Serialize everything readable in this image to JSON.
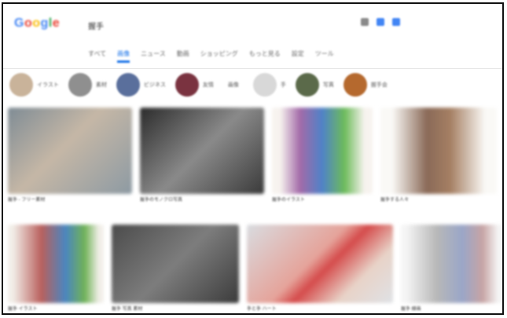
{
  "header": {
    "logo_letters": [
      {
        "char": "G",
        "color": "#4285f4"
      },
      {
        "char": "o",
        "color": "#ea4335"
      },
      {
        "char": "o",
        "color": "#fbbc05"
      },
      {
        "char": "g",
        "color": "#4285f4"
      },
      {
        "char": "l",
        "color": "#34a853"
      },
      {
        "char": "e",
        "color": "#ea4335"
      }
    ],
    "search_query": "握手",
    "icons": [
      {
        "name": "camera-search-icon",
        "color": "#8a8a8a"
      },
      {
        "name": "voice-mic-icon",
        "color": "#4285f4"
      },
      {
        "name": "search-icon",
        "color": "#4285f4"
      }
    ]
  },
  "tabs": [
    {
      "label": "すべて",
      "active": false
    },
    {
      "label": "画像",
      "active": true
    },
    {
      "label": "ニュース",
      "active": false
    },
    {
      "label": "動画",
      "active": false
    },
    {
      "label": "ショッピング",
      "active": false
    },
    {
      "label": "もっと見る",
      "active": false
    },
    {
      "label": "設定",
      "active": false
    },
    {
      "label": "ツール",
      "active": false
    }
  ],
  "chips": [
    {
      "label": "イラスト",
      "color": "#c9b39a"
    },
    {
      "label": "素材",
      "color": "#8f8f8f"
    },
    {
      "label": "ビジネス",
      "color": "#5a6f9c"
    },
    {
      "label": "友情",
      "color": "#7a3340"
    },
    {
      "label": "画像",
      "color": ""
    },
    {
      "label": "手",
      "color": "#d8d8d8"
    },
    {
      "label": "写真",
      "color": "#5b6a4a"
    },
    {
      "label": "握手会",
      "color": "#b5692e"
    }
  ],
  "results_row1": [
    {
      "caption": "握手 - フリー素材",
      "gradient": "linear-gradient(135deg,#7f8c95,#c5b7a6 45%,#8d9aa3)"
    },
    {
      "caption": "握手のモノクロ写真",
      "gradient": "linear-gradient(135deg,#2b2b2b,#8a8a8a 50%,#3a3a3a)"
    },
    {
      "caption": "握手のイラスト",
      "gradient": "linear-gradient(90deg,#f7f3ef 8%,#a36aa8 28%,#4f82c8 50%,#6dbb5a 72%,#f7f3ef 92%)"
    },
    {
      "caption": "握手する人々",
      "gradient": "linear-gradient(90deg,#faf9f6 10%,#8a6a58 40%,#a57f63 60%,#faf9f6 90%)"
    }
  ],
  "results_row2": [
    {
      "caption": "握手 イラスト",
      "gradient": "linear-gradient(90deg,#f2efe9 5%,#b9605d 35%,#4a86c0 60%,#70b257 80%,#f2efe9 95%)"
    },
    {
      "caption": "握手 写真 素材",
      "gradient": "linear-gradient(135deg,#4b4b4b,#7d7d7d 50%,#3b3b3b)"
    },
    {
      "caption": "手と手 ハート",
      "gradient": "linear-gradient(135deg,#d9dce0,#e5a39a 45%,#d54c4c 55%,#e8d3c8 75%,#dfe2e6)"
    },
    {
      "caption": "握手 線画",
      "gradient": "linear-gradient(90deg,#f5f5f5 5%,#b8b8b8 35%,#9aa6c8 60%,#c7a4a4 80%,#f5f5f5 95%)"
    }
  ]
}
